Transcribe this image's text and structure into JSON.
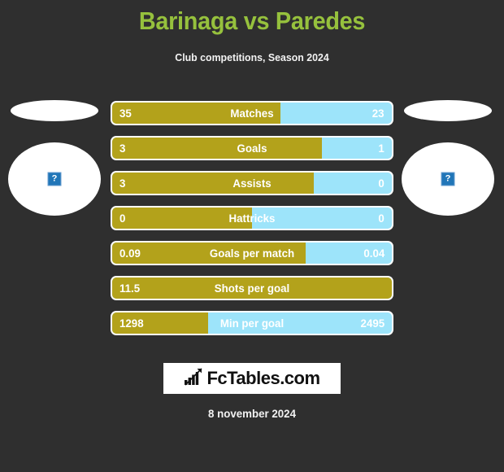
{
  "header": {
    "title": "Barinaga vs Paredes",
    "subtitle": "Club competitions, Season 2024",
    "title_color": "#96c13d"
  },
  "players": {
    "home": {
      "avatar_icon": "broken-image-icon",
      "avatar_glyph": "?",
      "name": ""
    },
    "away": {
      "avatar_icon": "broken-image-icon",
      "avatar_glyph": "?",
      "name": ""
    }
  },
  "colors": {
    "background": "#2f2f2f",
    "home_bar": "#b3a21b",
    "away_bar": "#9de4fa",
    "bar_outline": "#ffffff",
    "text": "#ffffff"
  },
  "chart_data": {
    "type": "bar",
    "title": "Barinaga vs Paredes",
    "subtitle": "Club competitions, Season 2024",
    "orientation": "horizontal-diverging",
    "series": [
      {
        "name": "Barinaga",
        "color": "#b3a21b",
        "values": [
          35,
          3,
          3,
          0,
          0.09,
          11.5,
          1298
        ]
      },
      {
        "name": "Paredes",
        "color": "#9de4fa",
        "values": [
          23,
          1,
          0,
          0,
          0.04,
          null,
          2495
        ]
      }
    ],
    "categories": [
      "Matches",
      "Goals",
      "Assists",
      "Hattricks",
      "Goals per match",
      "Shots per goal",
      "Min per goal"
    ]
  },
  "stats": [
    {
      "label": "Matches",
      "home": "35",
      "away": "23",
      "home_pct": 60.3
    },
    {
      "label": "Goals",
      "home": "3",
      "away": "1",
      "home_pct": 75.0
    },
    {
      "label": "Assists",
      "home": "3",
      "away": "0",
      "home_pct": 72.0
    },
    {
      "label": "Hattricks",
      "home": "0",
      "away": "0",
      "home_pct": 50.0
    },
    {
      "label": "Goals per match",
      "home": "0.09",
      "away": "0.04",
      "home_pct": 69.2
    },
    {
      "label": "Shots per goal",
      "home": "11.5",
      "away": "",
      "home_pct": 100.0
    },
    {
      "label": "Min per goal",
      "home": "1298",
      "away": "2495",
      "home_pct": 34.2
    }
  ],
  "logo": {
    "text": "FcTables.com",
    "icon": "bar-chart-arrow-icon"
  },
  "footer": {
    "date": "8 november 2024"
  }
}
